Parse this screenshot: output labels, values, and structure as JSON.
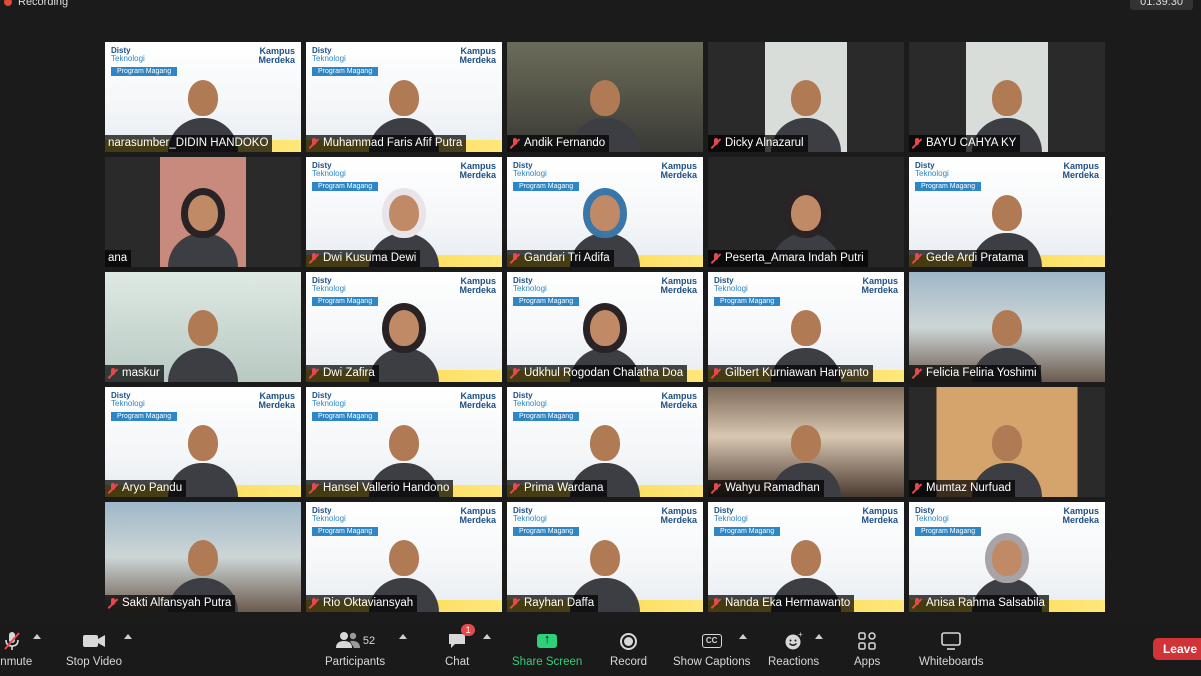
{
  "top": {
    "recording_label": "Recording",
    "timer": "01:39:30"
  },
  "banner": {
    "left_logo_line1": "Disty",
    "left_logo_line2": "Teknologi",
    "right_logo_line1": "Kampus",
    "right_logo_line2": "Merdeka",
    "chip": "Program Magang"
  },
  "participants": [
    {
      "name": "narasumber_DIDIN HANDOKO",
      "muted": false,
      "bg": "banner"
    },
    {
      "name": "Muhammad Faris Afif Putra",
      "muted": true,
      "bg": "banner"
    },
    {
      "name": "Andik Fernando",
      "muted": true,
      "bg": "room"
    },
    {
      "name": "Dicky Alnazarul",
      "muted": true,
      "bg": "window"
    },
    {
      "name": "BAYU CAHYA KY",
      "muted": true,
      "bg": "window"
    },
    {
      "name": "ana",
      "muted": false,
      "bg": "pinkroom",
      "active": true,
      "person": "hijab"
    },
    {
      "name": "Dwi Kusuma Dewi",
      "muted": true,
      "bg": "banner",
      "person": "hijab white"
    },
    {
      "name": "Gandari Tri Adifa",
      "muted": true,
      "bg": "banner",
      "person": "hijab blue"
    },
    {
      "name": "Peserta_Amara Indah Putri",
      "muted": true,
      "bg": "dark",
      "person": "hijab"
    },
    {
      "name": "Gede Ardi Pratama",
      "muted": true,
      "bg": "banner"
    },
    {
      "name": "maskur",
      "muted": true,
      "bg": "light"
    },
    {
      "name": "Dwi Zafira",
      "muted": true,
      "bg": "banner",
      "person": "hijab"
    },
    {
      "name": "Udkhul Rogodan Chalatha Doa",
      "muted": true,
      "bg": "banner",
      "person": "hijab"
    },
    {
      "name": "Gilbert Kurniawan Hariyanto",
      "muted": true,
      "bg": "banner"
    },
    {
      "name": "Felicia Feliria Yoshimi",
      "muted": true,
      "bg": "outdoor"
    },
    {
      "name": "Aryo Pandu",
      "muted": true,
      "bg": "banner"
    },
    {
      "name": "Hansel Vallerio Handono",
      "muted": true,
      "bg": "banner"
    },
    {
      "name": "Prima Wardana",
      "muted": true,
      "bg": "banner"
    },
    {
      "name": "Wahyu Ramadhan",
      "muted": true,
      "bg": "cafe"
    },
    {
      "name": "Mumtaz Nurfuad",
      "muted": true,
      "bg": "sunset"
    },
    {
      "name": "Sakti Alfansyah Putra",
      "muted": true,
      "bg": "outdoor"
    },
    {
      "name": "Rio Oktaviansyah",
      "muted": true,
      "bg": "banner"
    },
    {
      "name": "Rayhan Daffa",
      "muted": true,
      "bg": "banner"
    },
    {
      "name": "Nanda Eka Hermawanto",
      "muted": true,
      "bg": "banner"
    },
    {
      "name": "Anisa Rahma Salsabila",
      "muted": true,
      "bg": "banner",
      "person": "hijab gray"
    }
  ],
  "toolbar": {
    "unmute": "Unmute",
    "stop_video": "Stop Video",
    "participants": "Participants",
    "participants_count": "52",
    "chat": "Chat",
    "chat_badge": "1",
    "share_screen": "Share Screen",
    "record": "Record",
    "show_captions": "Show Captions",
    "cc": "CC",
    "reactions": "Reactions",
    "apps": "Apps",
    "whiteboards": "Whiteboards",
    "leave": "Leave"
  }
}
